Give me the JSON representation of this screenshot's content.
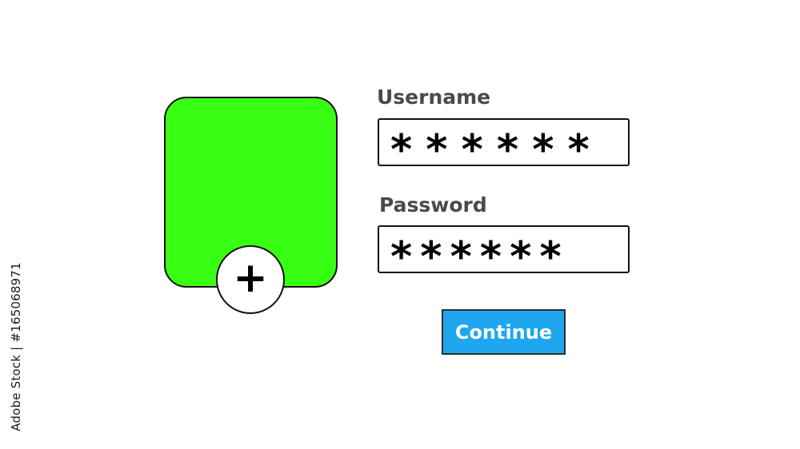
{
  "watermark": {
    "text": "Adobe Stock | #165068971"
  },
  "avatar": {
    "fill_color": "#39ff14",
    "add_icon": "plus-icon",
    "add_glyph": "+"
  },
  "login": {
    "username_label": "Username",
    "username_value": "******",
    "password_label": "Password",
    "password_value": "******",
    "continue_label": "Continue"
  },
  "colors": {
    "label": "#4a4a4a",
    "button_background": "#1ea7f0",
    "button_text": "#ffffff"
  }
}
